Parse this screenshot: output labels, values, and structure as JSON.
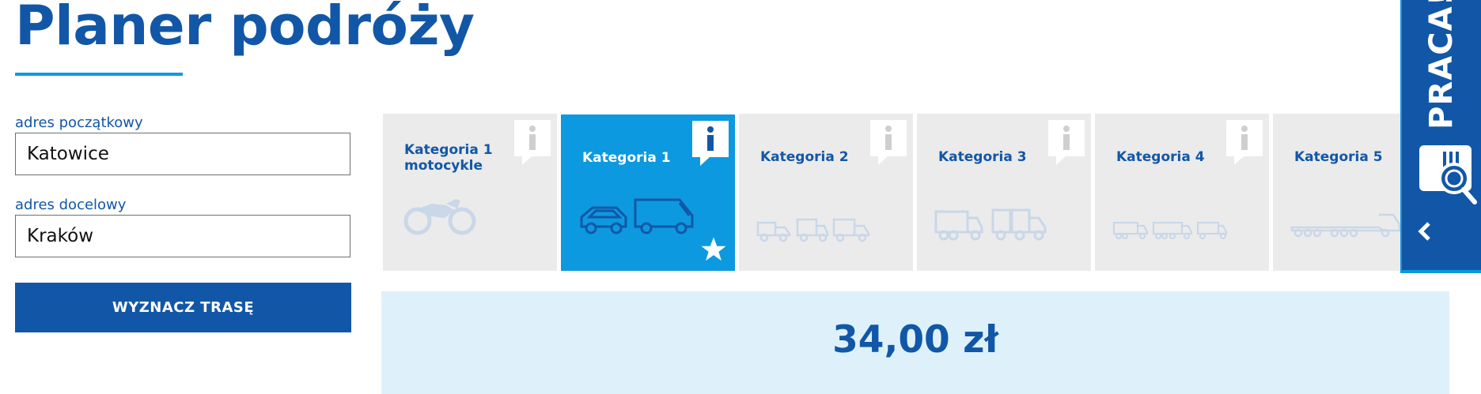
{
  "page": {
    "title": "Planer podróży"
  },
  "form": {
    "origin_label": "adres początkowy",
    "origin_value": "Katowice",
    "destination_label": "adres docelowy",
    "destination_value": "Kraków",
    "submit_label": "WYZNACZ TRASĘ"
  },
  "categories": [
    {
      "label_line1": "Kategoria 1",
      "label_line2": "motocykle",
      "icon": "motorcycle-icon",
      "active": false
    },
    {
      "label_line1": "Kategoria 1",
      "label_line2": "",
      "icon": "car-van-icon",
      "active": true
    },
    {
      "label_line1": "Kategoria 2",
      "label_line2": "",
      "icon": "light-trucks-icon",
      "active": false
    },
    {
      "label_line1": "Kategoria 3",
      "label_line2": "",
      "icon": "trucks-icon",
      "active": false
    },
    {
      "label_line1": "Kategoria 4",
      "label_line2": "",
      "icon": "heavy-trucks-icon",
      "active": false
    },
    {
      "label_line1": "Kategoria 5",
      "label_line2": "",
      "icon": "trailer-icon",
      "active": false
    }
  ],
  "price": {
    "value": "34,00 zł"
  },
  "side_panel": {
    "label": "PRACA!",
    "icon": "job-search-icon",
    "collapse_icon": "chevron-left-icon"
  },
  "colors": {
    "brand_blue": "#1257a7",
    "accent_blue": "#0d99df",
    "tile_gray": "#ebebeb",
    "price_bg": "#def1fb",
    "icon_light": "#c9d7e8"
  }
}
